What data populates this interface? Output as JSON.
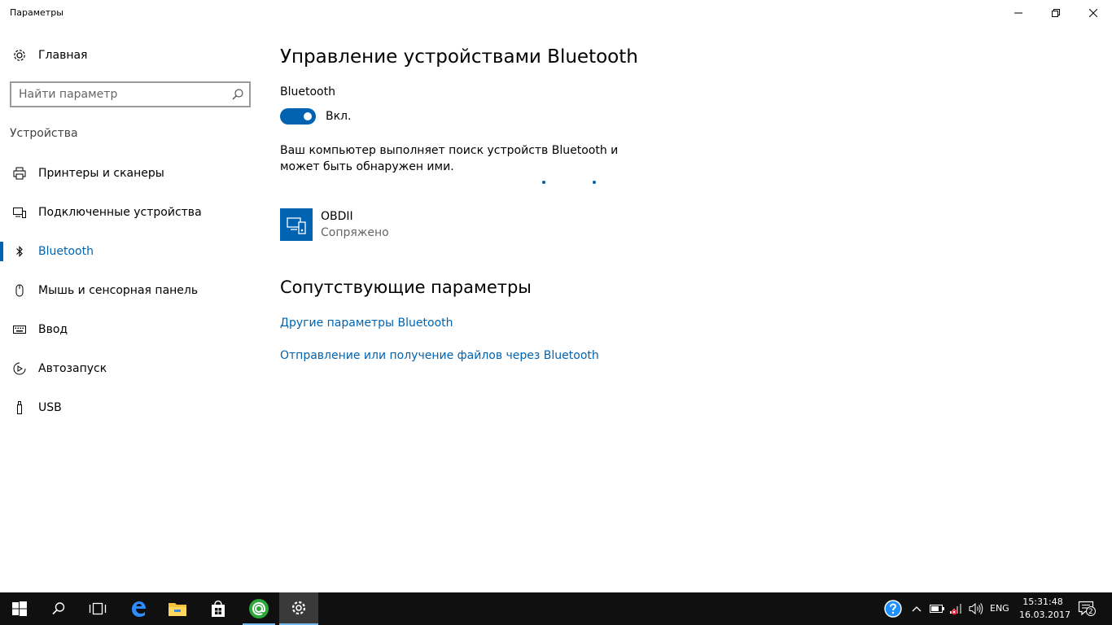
{
  "window": {
    "title": "Параметры",
    "minimize_icon": "minimize-icon",
    "maximize_icon": "restore-icon",
    "close_icon": "close-icon"
  },
  "sidebar": {
    "home_label": "Главная",
    "search_placeholder": "Найти параметр",
    "search_value": "",
    "section_label": "Устройства",
    "items": [
      {
        "label": "Принтеры и сканеры",
        "icon": "printer-icon"
      },
      {
        "label": "Подключенные устройства",
        "icon": "devices-icon"
      },
      {
        "label": "Bluetooth",
        "icon": "bluetooth-icon",
        "active": true
      },
      {
        "label": "Мышь и сенсорная панель",
        "icon": "mouse-icon"
      },
      {
        "label": "Ввод",
        "icon": "keyboard-icon"
      },
      {
        "label": "Автозапуск",
        "icon": "autoplay-icon"
      },
      {
        "label": "USB",
        "icon": "usb-icon"
      }
    ]
  },
  "main": {
    "title": "Управление устройствами Bluetooth",
    "bluetooth_label": "Bluetooth",
    "toggle_state": "Вкл.",
    "toggle_on": true,
    "description": "Ваш компьютер выполняет поиск устройств Bluetooth и может быть обнаружен ими.",
    "devices": [
      {
        "name": "OBDII",
        "status": "Сопряжено",
        "icon": "paired-device-icon"
      }
    ],
    "related_title": "Сопутствующие параметры",
    "links": [
      "Другие параметры Bluetooth",
      "Отправление или получение файлов через Bluetooth"
    ]
  },
  "taskbar": {
    "apps": [
      "start-icon",
      "search-icon",
      "task-view-icon",
      "edge-icon",
      "file-explorer-icon",
      "store-icon",
      "mail-ru-agent-icon",
      "settings-icon"
    ],
    "tray": [
      "help-icon",
      "show-hidden-icons",
      "battery-icon",
      "network-icon",
      "volume-icon"
    ],
    "language": "ENG",
    "time": "15:31:48",
    "date": "16.03.2017",
    "notification_count": "2"
  },
  "colors": {
    "accent": "#0063b1",
    "taskbar": "#101010"
  }
}
